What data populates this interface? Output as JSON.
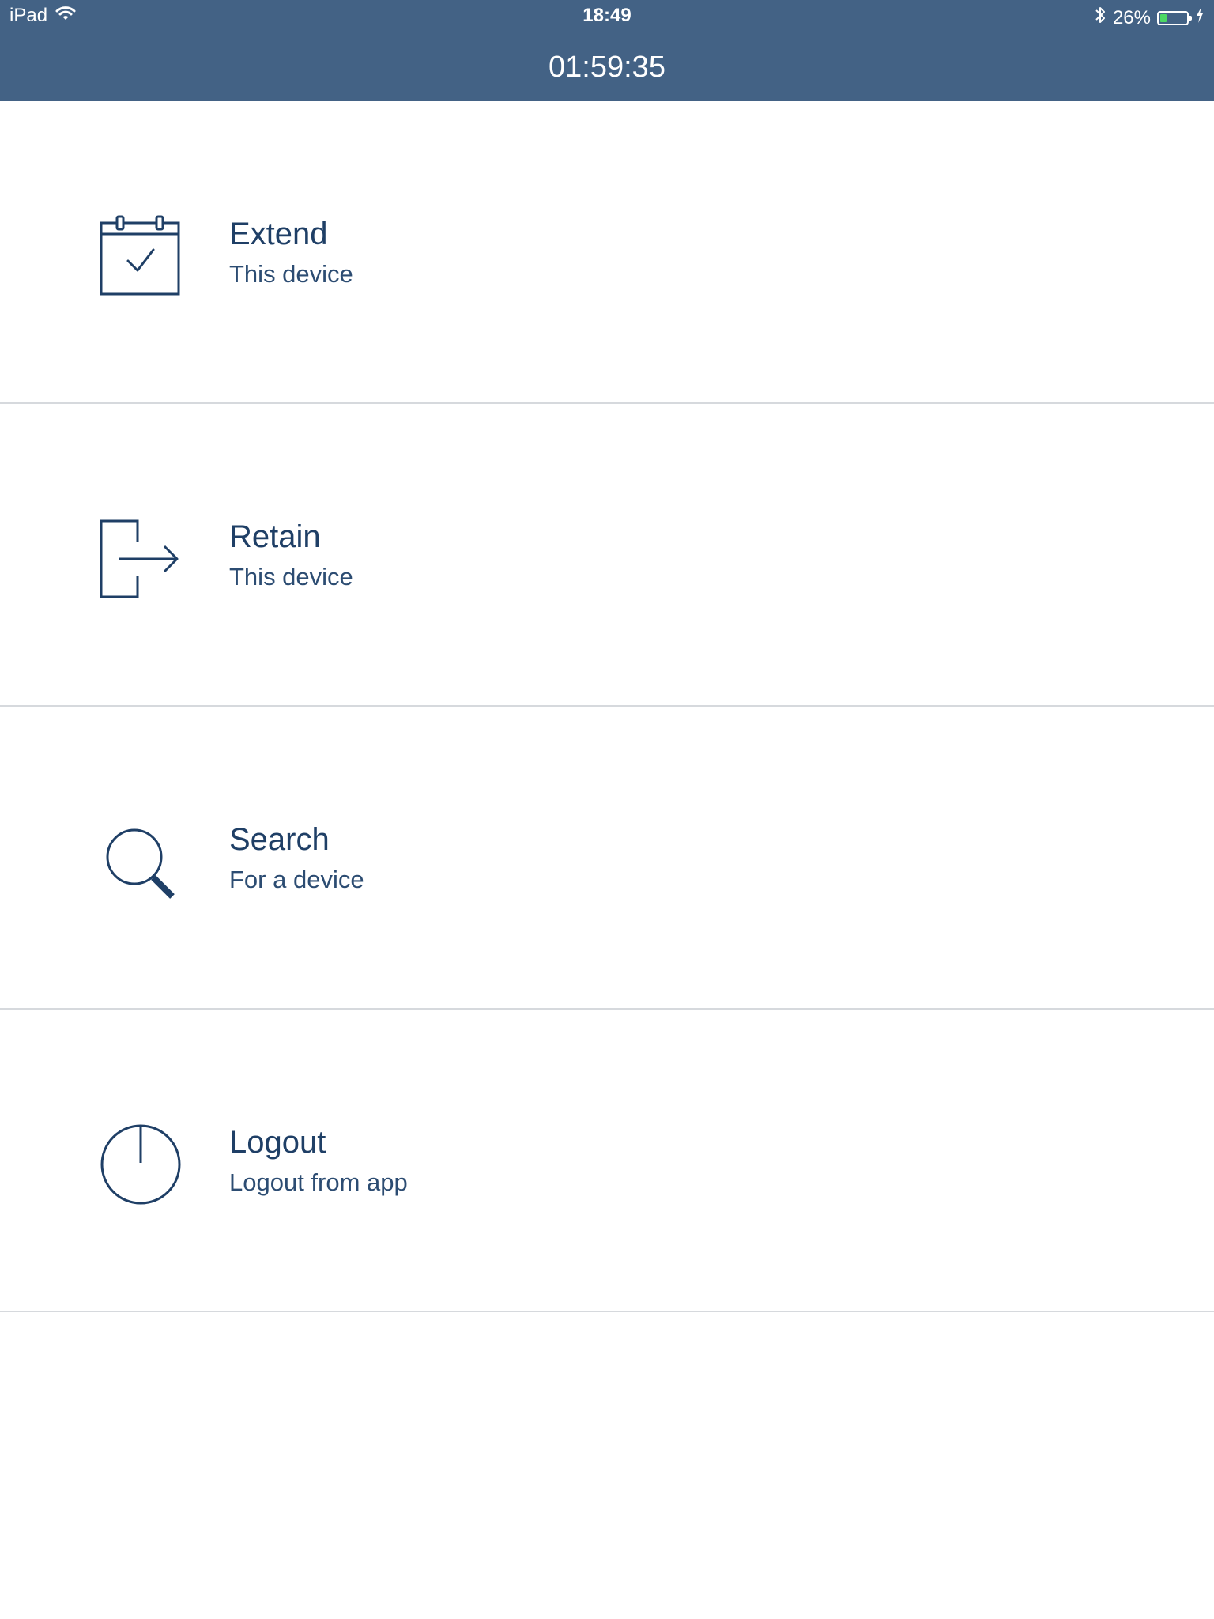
{
  "status_bar": {
    "device": "iPad",
    "time": "18:49",
    "battery_percent": "26%",
    "battery_level": 0.26,
    "wifi_icon": "wifi-icon",
    "bluetooth_icon": "bluetooth-icon",
    "charging_icon": "charging-bolt-icon"
  },
  "header": {
    "title": "01:59:35",
    "background_color": "#436285"
  },
  "menu": {
    "items": [
      {
        "title": "Extend",
        "subtitle": "This device",
        "icon": "calendar-check-icon"
      },
      {
        "title": "Retain",
        "subtitle": "This device",
        "icon": "exit-arrow-icon"
      },
      {
        "title": "Search",
        "subtitle": "For a device",
        "icon": "search-icon"
      },
      {
        "title": "Logout",
        "subtitle": "Logout from app",
        "icon": "power-icon"
      }
    ],
    "text_color": "#1f3f66",
    "divider_color": "#d6d9dd"
  }
}
